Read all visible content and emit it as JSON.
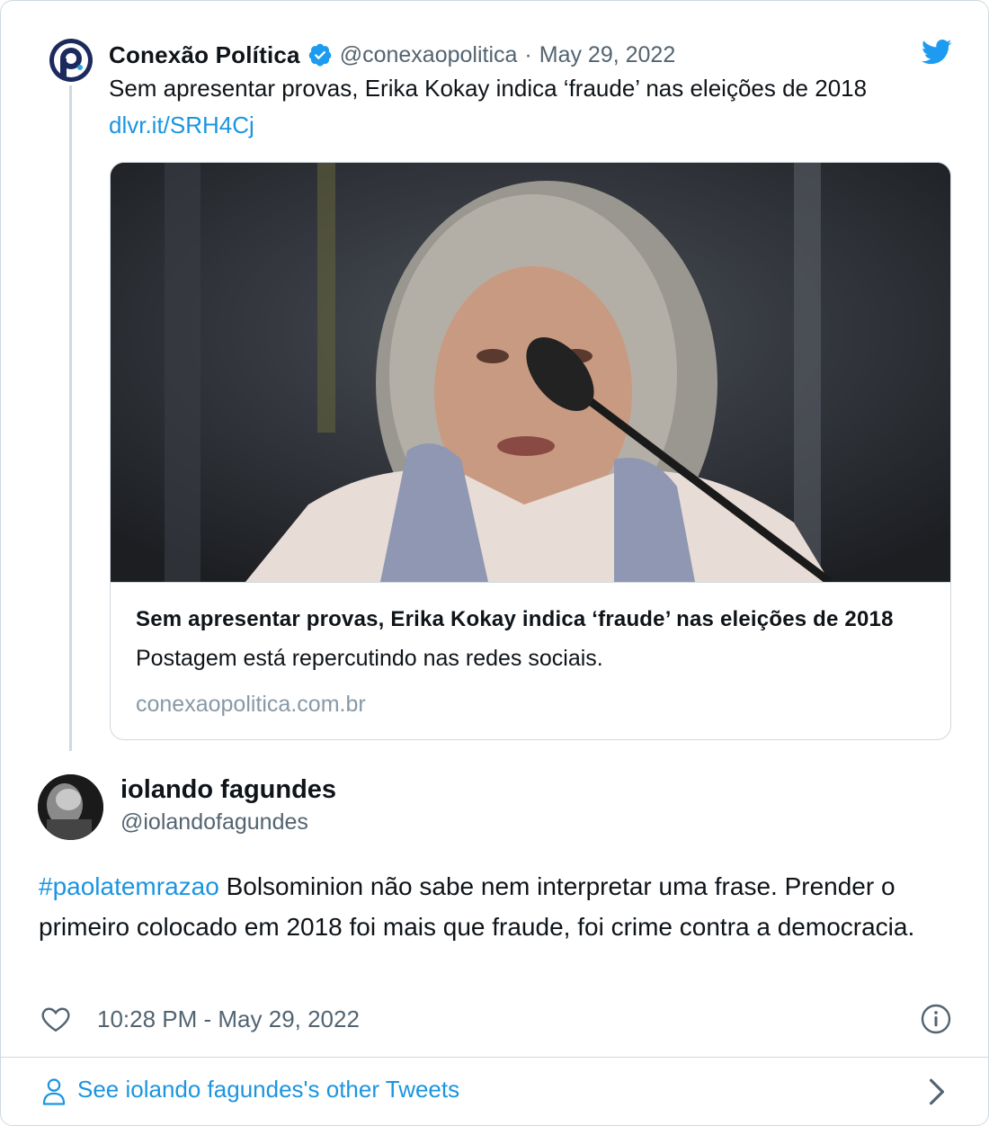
{
  "colors": {
    "link": "#1b95e0",
    "secondary_text": "#536471",
    "border": "#cfd9de",
    "verified": "#1d9bf0",
    "twitter_bird": "#1d9bf0"
  },
  "quoted_tweet": {
    "author_name": "Conexão Política",
    "handle": "@conexaopolitica",
    "separator": "·",
    "date": "May 29, 2022",
    "text": "Sem apresentar provas, Erika Kokay indica ‘fraude’ nas eleições de 2018",
    "link": "dlvr.it/SRH4Cj",
    "icons": [
      "conexao-politica-logo-icon",
      "verified-badge-icon",
      "twitter-bird-icon"
    ],
    "card": {
      "title": "Sem apresentar provas, Erika Kokay indica ‘fraude’ nas eleições de 2018",
      "description": "Postagem está repercutindo nas redes sociais.",
      "domain": "conexaopolitica.com.br"
    }
  },
  "tweet": {
    "author_name": "iolando fagundes",
    "handle": "@iolandofagundes",
    "hashtag": "#paolatemrazao",
    "text": " Bolsominion não sabe nem interpretar uma frase. Prender o primeiro colocado em 2018 foi mais que fraude, foi crime contra a democracia.",
    "timestamp": "10:28 PM - May 29, 2022",
    "icons": [
      "heart-icon",
      "info-icon"
    ]
  },
  "footer": {
    "label": "See iolando fagundes's other Tweets",
    "icons": [
      "person-icon",
      "chevron-right-icon"
    ]
  }
}
